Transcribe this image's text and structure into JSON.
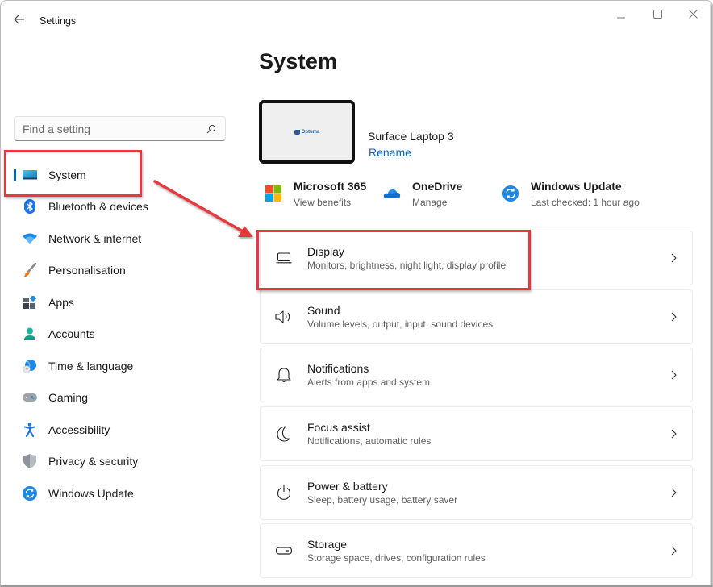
{
  "window": {
    "app_title": "Settings",
    "controls": {
      "minimize": "minimize",
      "maximize": "maximize",
      "close": "close"
    }
  },
  "search": {
    "placeholder": "Find a setting",
    "value": ""
  },
  "sidebar": {
    "items": [
      {
        "label": "System",
        "icon": "monitor-icon",
        "selected": true
      },
      {
        "label": "Bluetooth & devices",
        "icon": "bluetooth-icon"
      },
      {
        "label": "Network & internet",
        "icon": "wifi-icon"
      },
      {
        "label": "Personalisation",
        "icon": "paintbrush-icon"
      },
      {
        "label": "Apps",
        "icon": "apps-icon"
      },
      {
        "label": "Accounts",
        "icon": "person-icon"
      },
      {
        "label": "Time & language",
        "icon": "globe-clock-icon"
      },
      {
        "label": "Gaming",
        "icon": "gamepad-icon"
      },
      {
        "label": "Accessibility",
        "icon": "accessibility-icon"
      },
      {
        "label": "Privacy & security",
        "icon": "shield-icon"
      },
      {
        "label": "Windows Update",
        "icon": "sync-icon"
      }
    ]
  },
  "main": {
    "page_title": "System",
    "device": {
      "name": "Surface Laptop 3",
      "rename_label": "Rename",
      "thumbnail_logo": "Optuma"
    },
    "quick_links": [
      {
        "title": "Microsoft 365",
        "subtitle": "View benefits",
        "icon": "microsoft-logo-icon"
      },
      {
        "title": "OneDrive",
        "subtitle": "Manage",
        "icon": "cloud-icon"
      },
      {
        "title": "Windows Update",
        "subtitle": "Last checked: 1 hour ago",
        "icon": "sync-icon"
      }
    ],
    "cards": [
      {
        "title": "Display",
        "subtitle": "Monitors, brightness, night light, display profile",
        "icon": "laptop-icon"
      },
      {
        "title": "Sound",
        "subtitle": "Volume levels, output, input, sound devices",
        "icon": "speaker-icon"
      },
      {
        "title": "Notifications",
        "subtitle": "Alerts from apps and system",
        "icon": "bell-icon"
      },
      {
        "title": "Focus assist",
        "subtitle": "Notifications, automatic rules",
        "icon": "moon-icon"
      },
      {
        "title": "Power & battery",
        "subtitle": "Sleep, battery usage, battery saver",
        "icon": "power-icon"
      },
      {
        "title": "Storage",
        "subtitle": "Storage space, drives, configuration rules",
        "icon": "drive-icon"
      }
    ]
  },
  "annotations": {
    "color": "#e8383d",
    "highlighted": [
      "System",
      "Display"
    ]
  },
  "colors": {
    "accent": "#0067c0"
  }
}
